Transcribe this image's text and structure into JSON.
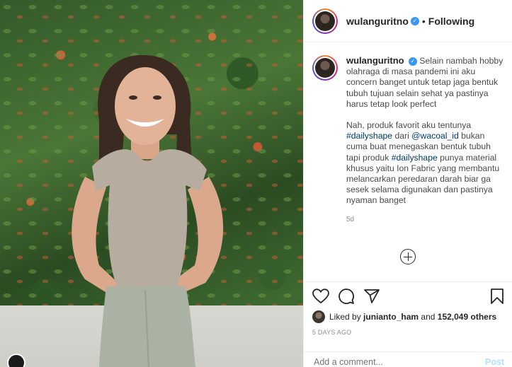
{
  "post": {
    "username": "wulanguritno",
    "header_separator": "•",
    "follow_status": "Following",
    "caption": {
      "p1": "Selain nambah hobby olahraga di masa pandemi ini aku concern banget untuk tetap jaga bentuk tubuh tujuan selain sehat ya pastinya harus tetap look perfect",
      "p2_a": "Nah, produk favorit aku tentunya",
      "hashtag_1": "#dailyshape",
      "p2_b": "dari",
      "mention": "@wacoal_id",
      "p2_c": "bukan cuma buat menegaskan bentuk tubuh tapi produk",
      "hashtag_2": "#dailyshape",
      "p2_d": "punya material khusus yaitu Ion Fabric yang membantu melancarkan peredaran darah biar ga sesek selama digunakan dan pastinya nyaman banget",
      "age": "5d"
    },
    "likes": {
      "prefix": "Liked by",
      "user": "junianto_ham",
      "middle": "and",
      "count": "152,049 others"
    },
    "time_ago": "5 DAYS AGO",
    "comment_placeholder": "Add a comment...",
    "post_button": "Post"
  },
  "colors": {
    "link": "#00376b",
    "verified": "#3897f0",
    "post_button_disabled": "#b2dffc"
  },
  "icons": [
    "verified-badge-icon",
    "more-plus-icon",
    "heart-icon",
    "comment-icon",
    "share-icon",
    "bookmark-icon"
  ]
}
